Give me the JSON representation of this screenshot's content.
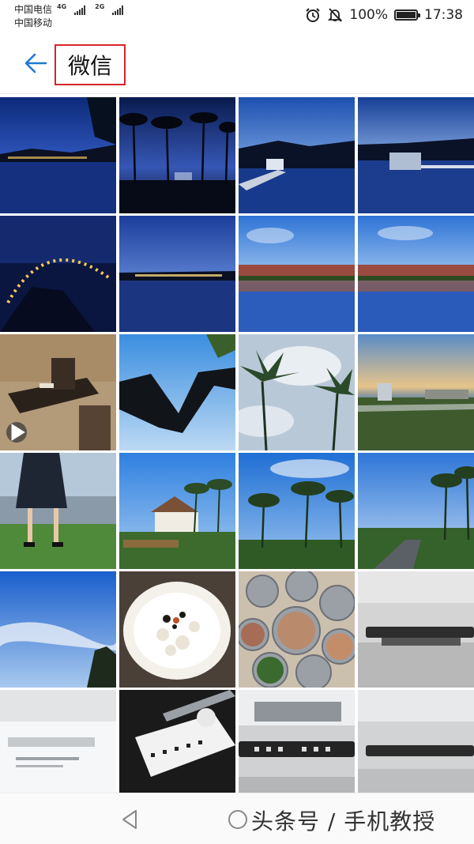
{
  "status_bar": {
    "carrier_1": "中国电信",
    "carrier_1_net": "4G",
    "carrier_2": "中国移动",
    "carrier_2_net": "2G",
    "alarm_icon": "alarm-clock-icon",
    "mute_icon": "bell-muted-icon",
    "battery_percent": "100%",
    "battery_level": 1.0,
    "time": "17:38"
  },
  "header": {
    "back_icon": "arrow-left-icon",
    "title": "微信",
    "title_highlight_color": "#d8232a",
    "accent_color": "#1e78d2"
  },
  "gallery": {
    "photos": [
      "night-lake-town",
      "palm-trees-dusk",
      "lake-bridge-dusk",
      "lake-villa-dusk",
      "lit-arch-bridge-night",
      "harbor-town-night",
      "resort-reflection-day",
      "resort-reflection-day-2",
      "dark-room-table-video",
      "heart-hands-sky",
      "palm-trees-cloudy",
      "resort-lawn-evening",
      "girls-on-grass",
      "resort-building-palms",
      "palm-trees-blue-sky",
      "palm-road-sunset",
      "blue-sky-clouds",
      "rice-bowl",
      "seafood-platters",
      "car-dashboard-plate",
      "product-box",
      "phone-number-card",
      "car-number-plate",
      "car-dashboard-plate-2"
    ],
    "video_play_icon": "play-icon"
  },
  "nav_bar": {
    "back_icon": "triangle-back-icon",
    "home_icon": "circle-home-icon",
    "watermark": "头条号 / 手机教授"
  }
}
